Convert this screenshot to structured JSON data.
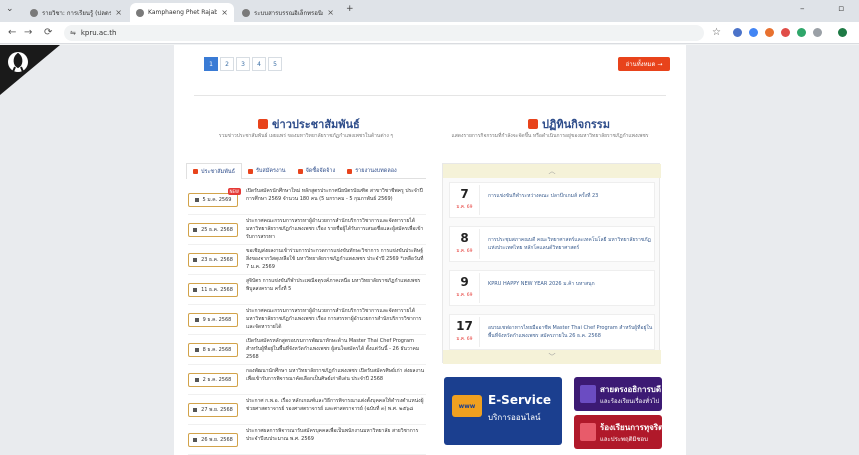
{
  "browser": {
    "tabs": [
      {
        "title": "รายวิชา: การเรียนรู้ (ปลดรอบการ"
      },
      {
        "title": "Kamphaeng Phet Rajabhat Uni"
      },
      {
        "title": "ระบบสารบรรณอิเล็กทรอนิกส์ | KPRU Ho"
      }
    ],
    "url": "kpru.ac.th"
  },
  "pagination": {
    "pages": [
      "1",
      "2",
      "3",
      "4",
      "5"
    ],
    "read_more": "อ่านทั้งหมด →"
  },
  "news": {
    "title": "ข่าวประชาสัมพันธ์",
    "subtitle": "รวมข่าวประชาสัมพันธ์ เผยแพร่ ของมหาวิทยาลัยราชภัฏกำแพงเพชรในด้านต่าง ๆ",
    "tabs": [
      "ประชาสัมพันธ์",
      "รับสมัครงาน",
      "จัดซื้อจัดจ้าง",
      "รายงานงบทดลอง"
    ],
    "new_label": "NEW",
    "items": [
      {
        "date": "5 ม.ค. 2569",
        "text": "เปิดรับสมัครนักศึกษาใหม่ หลักสูตรประกาศนียบัตรบัณฑิต สาขาวิชาชีพครู ประจำปีการศึกษา 2569 จำนวน 180 คน (5 มกราคม - 5 กุมภาพันธ์ 2569)"
      },
      {
        "date": "25 ธ.ค. 2568",
        "text": "ประกาศคณะกรรมการสรรหาผู้อำนวยการสำนักบริการวิชาการและจัดหารายได้ มหาวิทยาลัยราชภัฏกำแพงเพชร เรื่อง รายชื่อผู้ได้รับการเสนอชื่อและผู้สมัครเพื่อเข้ารับการสรรหา"
      },
      {
        "date": "23 ธ.ค. 2568",
        "text": "ขอเชิญส่งผลงานเข้าร่วมการประกวดการแข่งขันทักษะวิชาการ การแข่งขันประดิษฐ์สิ่งของจากวัสดุเหลือใช้ มหาวิทยาลัยราชภัฏกำแพงเพชร ประจำปี 2569 *เหลือวันที่ 7 ม.ค. 2569"
      },
      {
        "date": "11 ธ.ค. 2568",
        "text": "สูจิบัตร การแข่งขันกีฬาประเพณีจตุรงค์ภาคเหนือ มหาวิทยาลัยราชภัฏกำแพงเพชร พิบูลสงคราม ครั้งที่ 5"
      },
      {
        "date": "9 ธ.ค. 2568",
        "text": "ประกาศคณะกรรมการสรรหาผู้อำนวยการสำนักบริการวิชาการและจัดหารายได้ มหาวิทยาลัยราชภัฏกำแพงเพชร เรื่อง การสรรหาผู้อำนวยการสำนักบริการวิชาการและจัดหารายได้"
      },
      {
        "date": "8 ธ.ค. 2568",
        "text": "เปิดรับสมัครหลักสูตรอบรมการพัฒนาทักษะด้าน Master Thai Chef Program สำหรับผู้ที่อยู่ในพื้นที่จังหวัดกำแพงเพชร ผู้สนใจสมัครได้ ตั้งแต่วันนี้ - 26 ธันวาคม 2568"
      },
      {
        "date": "2 ธ.ค. 2568",
        "text": "กองพัฒนานักศึกษา มหาวิทยาลัยราชภัฏกำแพงเพชร เปิดรับสมัครศิษย์เก่า ส่งผลงานเพื่อเข้ารับการพิจารณาคัดเลือกเป็นศิษย์เก่าดีเด่น ประจำปี 2568"
      },
      {
        "date": "27 พ.ย. 2568",
        "text": "ประกาศ ก.พ.อ. เรื่อง หลักเกณฑ์และวิธีการพิจารณาแต่งตั้งบุคคลให้ดำรงตำแหน่งผู้ช่วยศาสตราจารย์ รองศาสตราจารย์ และศาสตราจารย์ (ฉบับที่ ๓) พ.ศ. ๒๕๖๘"
      },
      {
        "date": "26 พ.ย. 2568",
        "text": "ประกาศผลการพิจารณารับสมัครบุคคลเพื่อเป็นพนักงานมหาวิทยาลัย สายวิชาการ ประจำปีงบประมาณ พ.ศ. 2569"
      }
    ]
  },
  "activities": {
    "title": "ปฏิทินกิจกรรม",
    "subtitle": "แสดงรายการกิจกรรมที่กำลังจะจัดขึ้น หรือดำเนินการอยู่ของมหาวิทยาลัยราชภัฏกำแพงเพชร",
    "items": [
      {
        "day": "7",
        "month": "ม.ค. 69",
        "text": "การแข่งขันกีฬาระหว่างคณะ ปลาบึกเกมส์ ครั้งที่ 23"
      },
      {
        "day": "8",
        "month": "ม.ค. 69",
        "text": "การประชุมสภาคณบดี คณะวิทยาศาสตร์และเทคโนโลยี มหาวิทยาลัยราชภัฏแห่งประเทศไทย หลักโคแลนด์วิทยาศาสตร์"
      },
      {
        "day": "9",
        "month": "ม.ค. 69",
        "text": "KPRU HAPPY NEW YEAR 2026 ม.ค้า บหาสนุก"
      },
      {
        "day": "17",
        "month": "ม.ค. 69",
        "text": "อบรมเชฟอาหารไทยมืออาชีพ Master Thai Chef Program สำหรับผู้ที่อยู่ในพื้นที่จังหวัดกำแพงเพชร สมัครภายใน 26 ธ.ค. 2568"
      }
    ]
  },
  "banners": {
    "eservice": {
      "icon_text": "www",
      "title": "E-Service",
      "subtitle": "บริการออนไลน์"
    },
    "hotline": {
      "title": "สายตรงอธิการบดี",
      "subtitle": "และร้องเรียนเรื่องทั่วไป"
    },
    "complaint": {
      "title": "ร้องเรียนการทุจริต",
      "subtitle": "และประพฤติมิชอบ"
    }
  }
}
